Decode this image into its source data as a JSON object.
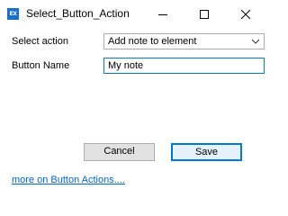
{
  "window": {
    "icon_text": "EX",
    "title": "Select_Button_Action"
  },
  "form": {
    "select_action_label": "Select action",
    "select_action_value": "Add note to element",
    "button_name_label": "Button Name",
    "button_name_value": "My note"
  },
  "buttons": {
    "cancel_label": "Cancel",
    "save_label": "Save"
  },
  "link": {
    "text": "more on Button Actions...."
  },
  "icons": {
    "app": "ex-app-icon",
    "minimize": "minimize-icon",
    "maximize": "maximize-icon",
    "close": "close-icon",
    "dropdown": "chevron-down-icon"
  },
  "colors": {
    "accent": "#0078d7",
    "app_icon": "#1c6fc9",
    "link": "#0066cc"
  }
}
